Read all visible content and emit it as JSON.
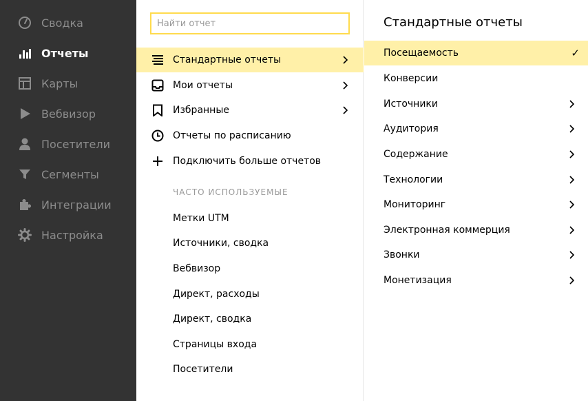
{
  "sidebar": {
    "items": [
      {
        "label": "Сводка",
        "icon": "gauge-icon"
      },
      {
        "label": "Отчеты",
        "icon": "bar-chart-icon",
        "active": true
      },
      {
        "label": "Карты",
        "icon": "layout-map-icon"
      },
      {
        "label": "Вебвизор",
        "icon": "play-icon"
      },
      {
        "label": "Посетители",
        "icon": "person-icon"
      },
      {
        "label": "Сегменты",
        "icon": "funnel-icon"
      },
      {
        "label": "Интеграции",
        "icon": "puzzle-icon"
      },
      {
        "label": "Настройка",
        "icon": "gear-icon"
      }
    ]
  },
  "search": {
    "placeholder": "Найти отчет",
    "value": ""
  },
  "menu": {
    "items": [
      {
        "label": "Стандартные отчеты",
        "icon": "list-lines-icon",
        "active": true
      },
      {
        "label": "Мои отчеты",
        "icon": "inbox-icon"
      },
      {
        "label": "Избранные",
        "icon": "bookmark-icon"
      },
      {
        "label": "Отчеты по расписанию",
        "icon": "clock-icon"
      },
      {
        "label": "Подключить больше отчетов",
        "icon": "plus-icon"
      }
    ]
  },
  "frequent": {
    "title": "ЧАСТО ИСПОЛЬЗУЕМЫЕ",
    "items": [
      "Метки UTM",
      "Источники, сводка",
      "Вебвизор",
      "Директ, расходы",
      "Директ, сводка",
      "Страницы входа",
      "Посетители"
    ]
  },
  "standard": {
    "title": "Стандартные отчеты",
    "items": [
      {
        "label": "Посещаемость",
        "selected": true
      },
      {
        "label": "Конверсии"
      },
      {
        "label": "Источники"
      },
      {
        "label": "Аудитория"
      },
      {
        "label": "Содержание"
      },
      {
        "label": "Технологии"
      },
      {
        "label": "Мониторинг"
      },
      {
        "label": "Электронная коммерция"
      },
      {
        "label": "Звонки"
      },
      {
        "label": "Монетизация"
      }
    ],
    "check_mark": "✓"
  },
  "colors": {
    "sidebar_bg": "#333333",
    "accent_yellow": "#fff0a8",
    "search_border": "#ffdb4d",
    "muted_text": "#8c8c8c"
  }
}
